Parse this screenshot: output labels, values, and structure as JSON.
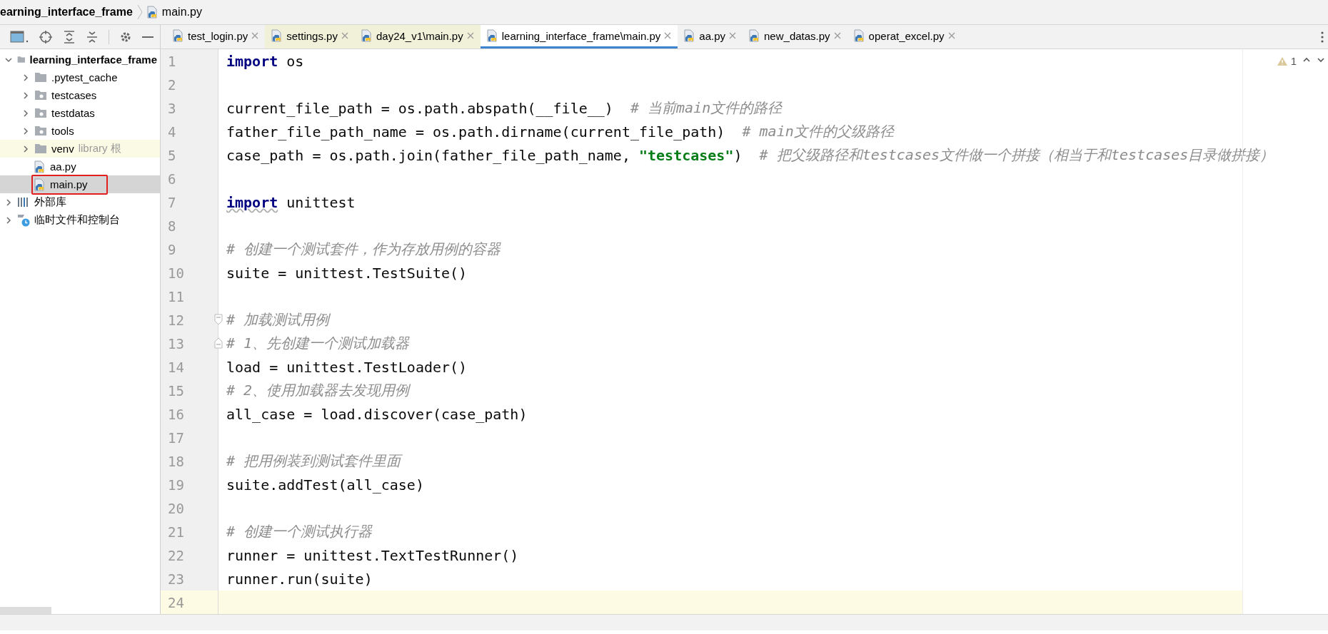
{
  "breadcrumb": [
    {
      "label": "earning_interface_frame",
      "kind": "folder"
    },
    {
      "label": "main.py",
      "kind": "python"
    }
  ],
  "project_tree": [
    {
      "label": "learning_interface_frame",
      "kind": "folder",
      "expanded": true,
      "selected": false,
      "children": [
        {
          "label": ".pytest_cache",
          "kind": "folder",
          "expanded": false,
          "selected": false
        },
        {
          "label": "testcases",
          "kind": "package",
          "expanded": false,
          "selected": false
        },
        {
          "label": "testdatas",
          "kind": "package",
          "expanded": false,
          "selected": false
        },
        {
          "label": "tools",
          "kind": "package",
          "expanded": false,
          "selected": false
        },
        {
          "label": "venv",
          "hint": "library 根",
          "kind": "folder",
          "expanded": false,
          "selected": false,
          "library_root": true
        },
        {
          "label": "aa.py",
          "kind": "python",
          "selected": false
        },
        {
          "label": "main.py",
          "kind": "python",
          "selected": true,
          "annotated": true
        }
      ]
    },
    {
      "label": "外部库",
      "kind": "library",
      "expanded": false,
      "selected": false
    },
    {
      "label": "临时文件和控制台",
      "kind": "scratch",
      "expanded": false,
      "selected": false
    }
  ],
  "tabs": [
    {
      "label": "test_login.py",
      "selected": false,
      "non_project": false
    },
    {
      "label": "settings.py",
      "selected": false,
      "non_project": true
    },
    {
      "label": "day24_v1\\main.py",
      "selected": false,
      "non_project": true
    },
    {
      "label": "learning_interface_frame\\main.py",
      "selected": true,
      "non_project": false
    },
    {
      "label": "aa.py",
      "selected": false,
      "non_project": false
    },
    {
      "label": "new_datas.py",
      "selected": false,
      "non_project": false
    },
    {
      "label": "operat_excel.py",
      "selected": false,
      "non_project": false
    }
  ],
  "editor": {
    "warning_count": "1",
    "lines": [
      {
        "number": "1",
        "current": false,
        "segments": [
          {
            "kind": "keyword",
            "text": "import"
          },
          {
            "kind": "text",
            "text": " os"
          }
        ]
      },
      {
        "number": "2",
        "current": false
      },
      {
        "number": "3",
        "current": false,
        "segments": [
          {
            "kind": "text",
            "text": "current_file_path = os.path.abspath(__file__)  "
          },
          {
            "kind": "comment",
            "text": "# 当前main文件的路径"
          }
        ]
      },
      {
        "number": "4",
        "current": false,
        "segments": [
          {
            "kind": "text",
            "text": "father_file_path_name = os.path.dirname(current_file_path)  "
          },
          {
            "kind": "comment",
            "text": "# main文件的父级路径"
          }
        ]
      },
      {
        "number": "5",
        "current": false,
        "segments": [
          {
            "kind": "text",
            "text": "case_path = os.path.join(father_file_path_name, "
          },
          {
            "kind": "string",
            "text": "\"testcases\""
          },
          {
            "kind": "text",
            "text": ")  "
          },
          {
            "kind": "comment",
            "text": "# 把父级路径和testcases文件做一个拼接（相当于和testcases目录做拼接）"
          }
        ]
      },
      {
        "number": "6",
        "current": false
      },
      {
        "number": "7",
        "current": false,
        "segments": [
          {
            "kind": "keyword_warning",
            "text": "import"
          },
          {
            "kind": "text",
            "text": " unittest"
          }
        ]
      },
      {
        "number": "8",
        "current": false
      },
      {
        "number": "9",
        "current": false,
        "segments": [
          {
            "kind": "comment",
            "text": "# 创建一个测试套件，作为存放用例的容器"
          }
        ]
      },
      {
        "number": "10",
        "current": false,
        "segments": [
          {
            "kind": "text",
            "text": "suite = unittest.TestSuite()"
          }
        ]
      },
      {
        "number": "11",
        "current": false
      },
      {
        "number": "12",
        "current": false,
        "fold_start": true,
        "segments": [
          {
            "kind": "comment",
            "text": "# 加载测试用例"
          }
        ]
      },
      {
        "number": "13",
        "current": false,
        "fold_end": true,
        "segments": [
          {
            "kind": "comment",
            "text": "# 1、先创建一个测试加载器"
          }
        ]
      },
      {
        "number": "14",
        "current": false,
        "segments": [
          {
            "kind": "text",
            "text": "load = unittest.TestLoader()"
          }
        ]
      },
      {
        "number": "15",
        "current": false,
        "segments": [
          {
            "kind": "comment",
            "text": "# 2、使用加载器去发现用例"
          }
        ]
      },
      {
        "number": "16",
        "current": false,
        "segments": [
          {
            "kind": "text",
            "text": "all_case = load.discover(case_path)"
          }
        ]
      },
      {
        "number": "17",
        "current": false
      },
      {
        "number": "18",
        "current": false,
        "segments": [
          {
            "kind": "comment",
            "text": "# 把用例装到测试套件里面"
          }
        ]
      },
      {
        "number": "19",
        "current": false,
        "segments": [
          {
            "kind": "text",
            "text": "suite.addTest(all_case)"
          }
        ]
      },
      {
        "number": "20",
        "current": false
      },
      {
        "number": "21",
        "current": false,
        "segments": [
          {
            "kind": "comment",
            "text": "# 创建一个测试执行器"
          }
        ]
      },
      {
        "number": "22",
        "current": false,
        "segments": [
          {
            "kind": "text",
            "text": "runner = unittest.TextTestRunner()"
          }
        ]
      },
      {
        "number": "23",
        "current": false,
        "segments": [
          {
            "kind": "text",
            "text": "runner.run(suite)"
          }
        ]
      },
      {
        "number": "24",
        "current": true
      }
    ]
  }
}
